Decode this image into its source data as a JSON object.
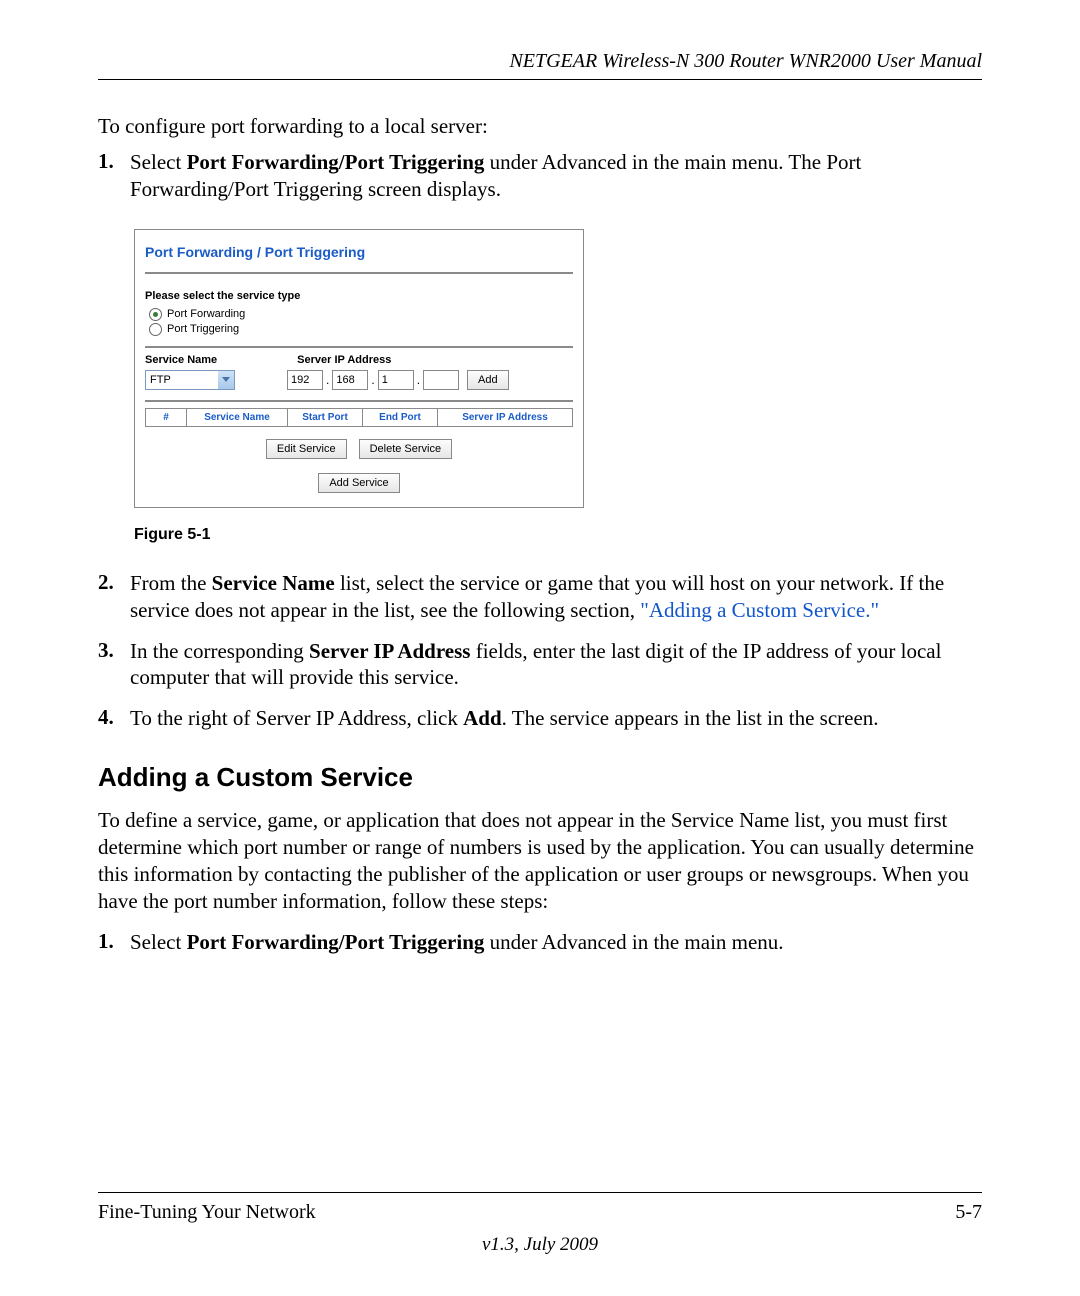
{
  "header": {
    "title": "NETGEAR Wireless-N 300 Router WNR2000 User Manual"
  },
  "intro": "To configure port forwarding to a local server:",
  "list1": [
    {
      "num": "1.",
      "pre": "Select ",
      "bold": "Port Forwarding/Port Triggering",
      "post": " under Advanced in the main menu. The Port Forwarding/Port Triggering screen displays."
    }
  ],
  "router": {
    "title": "Port Forwarding / Port Triggering",
    "select_label": "Please select the service type",
    "radio_forwarding": "Port Forwarding",
    "radio_triggering": "Port Triggering",
    "service_name_label": "Service Name",
    "server_ip_label": "Server IP Address",
    "service_selected": "FTP",
    "ip1": "192",
    "ip2": "168",
    "ip3": "1",
    "ip4": "",
    "add_btn": "Add",
    "table": {
      "col_num": "#",
      "col_service": "Service Name",
      "col_start": "Start Port",
      "col_end": "End Port",
      "col_ip": "Server IP Address"
    },
    "edit_btn": "Edit Service",
    "delete_btn": "Delete Service",
    "add_service_btn": "Add Service"
  },
  "figure_caption": "Figure 5-1",
  "list2": [
    {
      "num": "2.",
      "pre": "From the ",
      "bold": "Service Name",
      "mid": " list, select the service or game that you will host on your network. If the service does not appear in the list, see the following section, ",
      "link": "\"Adding a Custom Service.\""
    },
    {
      "num": "3.",
      "pre": "In the corresponding ",
      "bold": "Server IP Address",
      "post": " fields, enter the last digit of the IP address of your local computer that will provide this service."
    },
    {
      "num": "4.",
      "pre": "To the right of Server IP Address, click ",
      "bold": "Add",
      "post": ". The service appears in the list in the screen."
    }
  ],
  "section_heading": "Adding a Custom Service",
  "section_para": "To define a service, game, or application that does not appear in the Service Name list, you must first determine which port number or range of numbers is used by the application. You can usually determine this information by contacting the publisher of the application or user groups or newsgroups. When you have the port number information, follow these steps:",
  "list3": [
    {
      "num": "1.",
      "pre": "Select ",
      "bold": "Port Forwarding/Port Triggering",
      "post": " under Advanced in the main menu."
    }
  ],
  "footer": {
    "left": "Fine-Tuning Your Network",
    "right": "5-7",
    "version": "v1.3, July 2009"
  }
}
